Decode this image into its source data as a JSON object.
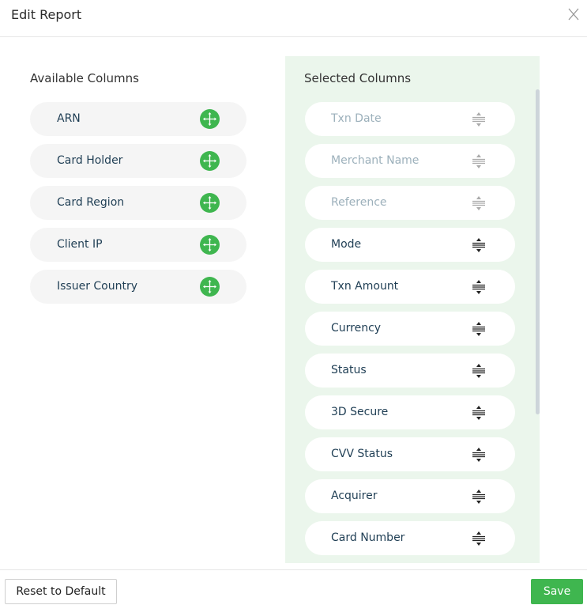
{
  "header": {
    "title": "Edit Report",
    "close_icon": "close-icon"
  },
  "available": {
    "title": "Available Columns",
    "items": [
      {
        "label": "ARN",
        "icon": "add-move-icon"
      },
      {
        "label": "Card Holder",
        "icon": "add-move-icon"
      },
      {
        "label": "Card Region",
        "icon": "add-move-icon"
      },
      {
        "label": "Client IP",
        "icon": "add-move-icon"
      },
      {
        "label": "Issuer Country",
        "icon": "add-move-icon"
      }
    ]
  },
  "selected": {
    "title": "Selected Columns",
    "items": [
      {
        "label": "Txn Date",
        "disabled": true
      },
      {
        "label": "Merchant Name",
        "disabled": true
      },
      {
        "label": "Reference",
        "disabled": true
      },
      {
        "label": "Mode",
        "disabled": false
      },
      {
        "label": "Txn Amount",
        "disabled": false
      },
      {
        "label": "Currency",
        "disabled": false
      },
      {
        "label": "Status",
        "disabled": false
      },
      {
        "label": "3D Secure",
        "disabled": false
      },
      {
        "label": "CVV Status",
        "disabled": false
      },
      {
        "label": "Acquirer",
        "disabled": false
      },
      {
        "label": "Card Number",
        "disabled": false
      }
    ]
  },
  "footer": {
    "reset_label": "Reset to Default",
    "save_label": "Save"
  },
  "colors": {
    "accent": "#3fb64f",
    "panel_bg": "#ebf6ec",
    "text": "#1f3e54",
    "disabled_text": "#9cb0bb"
  }
}
